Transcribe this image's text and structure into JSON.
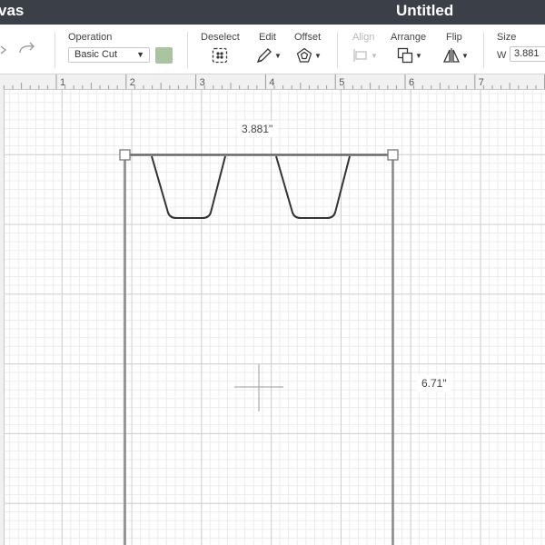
{
  "titlebar": {
    "left_fragment": "vas",
    "document_title": "Untitled"
  },
  "toolbar": {
    "operation": {
      "label": "Operation",
      "value": "Basic Cut"
    },
    "swatch_color": "#a8c4a0",
    "deselect": {
      "label": "Deselect",
      "icon": "deselect-icon"
    },
    "edit": {
      "label": "Edit",
      "icon": "pen-icon"
    },
    "offset": {
      "label": "Offset",
      "icon": "offset-icon"
    },
    "align": {
      "label": "Align",
      "icon": "align-icon",
      "disabled": true
    },
    "arrange": {
      "label": "Arrange",
      "icon": "arrange-icon"
    },
    "flip": {
      "label": "Flip",
      "icon": "flip-icon"
    },
    "size": {
      "label": "Size",
      "w_label": "W",
      "w_value": "3.881"
    }
  },
  "ruler": {
    "marks": [
      "1",
      "2",
      "3",
      "4",
      "5",
      "6",
      "7"
    ]
  },
  "canvas": {
    "selection_width": "3.881\"",
    "selection_height": "6.71\""
  }
}
